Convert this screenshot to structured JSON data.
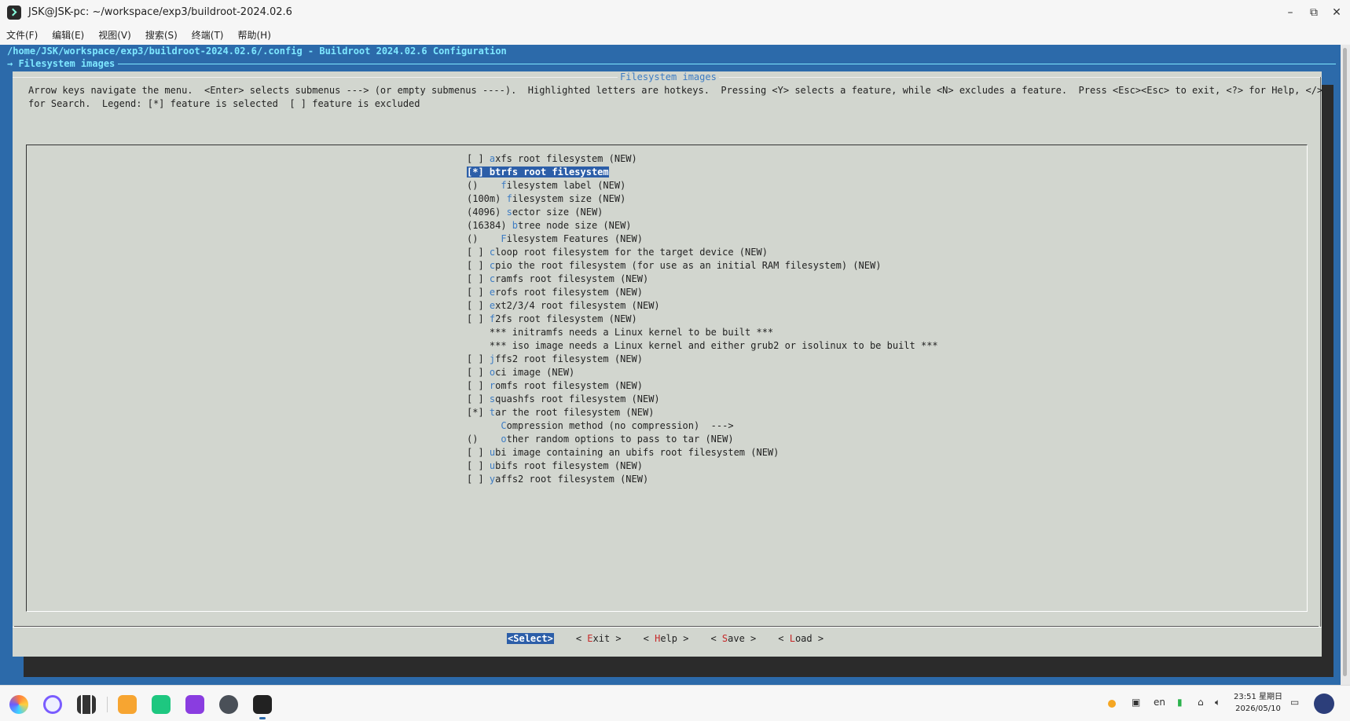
{
  "window": {
    "title": "JSK@JSK-pc: ~/workspace/exp3/buildroot-2024.02.6",
    "minimize": "–",
    "restore": "⧉",
    "close": "✕"
  },
  "menubar": [
    "文件(F)",
    "编辑(E)",
    "视图(V)",
    "搜索(S)",
    "终端(T)",
    "帮助(H)"
  ],
  "terminal": {
    "path": "/home/JSK/workspace/exp3/buildroot-2024.02.6/.config - Buildroot 2024.02.6 Configuration",
    "breadcrumb": "→ Filesystem images",
    "dialog_title": "Filesystem images",
    "help_line1": "Arrow keys navigate the menu.  <Enter> selects submenus ---> (or empty submenus ----).  Highlighted letters are hotkeys.  Pressing <Y> selects a feature, while <N> excludes a feature.  Press <Esc><Esc> to exit, <?> for Help, </>",
    "help_line2": "for Search.  Legend: [*] feature is selected  [ ] feature is excluded",
    "items": [
      {
        "pre": "[ ] ",
        "hk": "a",
        "post": "xfs root filesystem (NEW)"
      },
      {
        "pre": "[*] ",
        "hk": "b",
        "post": "trfs root filesystem",
        "selected": true
      },
      {
        "pre": "()    ",
        "hk": "f",
        "post": "ilesystem label (NEW)"
      },
      {
        "pre": "(100m) ",
        "hk": "f",
        "post": "ilesystem size (NEW)"
      },
      {
        "pre": "(4096) ",
        "hk": "s",
        "post": "ector size (NEW)"
      },
      {
        "pre": "(16384) ",
        "hk": "b",
        "post": "tree node size (NEW)"
      },
      {
        "pre": "()    ",
        "hk": "F",
        "post": "ilesystem Features (NEW)"
      },
      {
        "pre": "[ ] ",
        "hk": "c",
        "post": "loop root filesystem for the target device (NEW)"
      },
      {
        "pre": "[ ] ",
        "hk": "c",
        "post": "pio the root filesystem (for use as an initial RAM filesystem) (NEW)"
      },
      {
        "pre": "[ ] ",
        "hk": "c",
        "post": "ramfs root filesystem (NEW)"
      },
      {
        "pre": "[ ] ",
        "hk": "e",
        "post": "rofs root filesystem (NEW)"
      },
      {
        "pre": "[ ] ",
        "hk": "e",
        "post": "xt2/3/4 root filesystem (NEW)"
      },
      {
        "pre": "[ ] ",
        "hk": "f",
        "post": "2fs root filesystem (NEW)"
      },
      {
        "pre": "    ",
        "hk": "",
        "post": "*** initramfs needs a Linux kernel to be built ***"
      },
      {
        "pre": "    ",
        "hk": "",
        "post": "*** iso image needs a Linux kernel and either grub2 or isolinux to be built ***"
      },
      {
        "pre": "[ ] ",
        "hk": "j",
        "post": "ffs2 root filesystem (NEW)"
      },
      {
        "pre": "[ ] ",
        "hk": "o",
        "post": "ci image (NEW)"
      },
      {
        "pre": "[ ] ",
        "hk": "r",
        "post": "omfs root filesystem (NEW)"
      },
      {
        "pre": "[ ] ",
        "hk": "s",
        "post": "quashfs root filesystem (NEW)"
      },
      {
        "pre": "[*] ",
        "hk": "t",
        "post": "ar the root filesystem (NEW)"
      },
      {
        "pre": "      ",
        "hk": "C",
        "post": "ompression method (no compression)  --->"
      },
      {
        "pre": "()    ",
        "hk": "o",
        "post": "ther random options to pass to tar (NEW)"
      },
      {
        "pre": "[ ] ",
        "hk": "u",
        "post": "bi image containing an ubifs root filesystem (NEW)"
      },
      {
        "pre": "[ ] ",
        "hk": "u",
        "post": "bifs root filesystem (NEW)"
      },
      {
        "pre": "[ ] ",
        "hk": "y",
        "post": "affs2 root filesystem (NEW)"
      }
    ],
    "buttons": [
      {
        "pre": "<",
        "hk": "S",
        "post": "elect>",
        "active": true
      },
      {
        "pre": "< ",
        "hk": "E",
        "post": "xit >",
        "active": false
      },
      {
        "pre": "< ",
        "hk": "H",
        "post": "elp >",
        "active": false
      },
      {
        "pre": "< ",
        "hk": "S",
        "post": "ave >",
        "active": false
      },
      {
        "pre": "< ",
        "hk": "L",
        "post": "oad >",
        "active": false
      }
    ]
  },
  "taskbar": {
    "apps": [
      "launcher-icon",
      "search-icon",
      "multitask-icon",
      "file-manager-icon",
      "chat-icon",
      "camera-icon",
      "settings-icon",
      "terminal-icon"
    ],
    "lang": "en",
    "time": "23:51 星期日",
    "date": "2026/05/10"
  }
}
